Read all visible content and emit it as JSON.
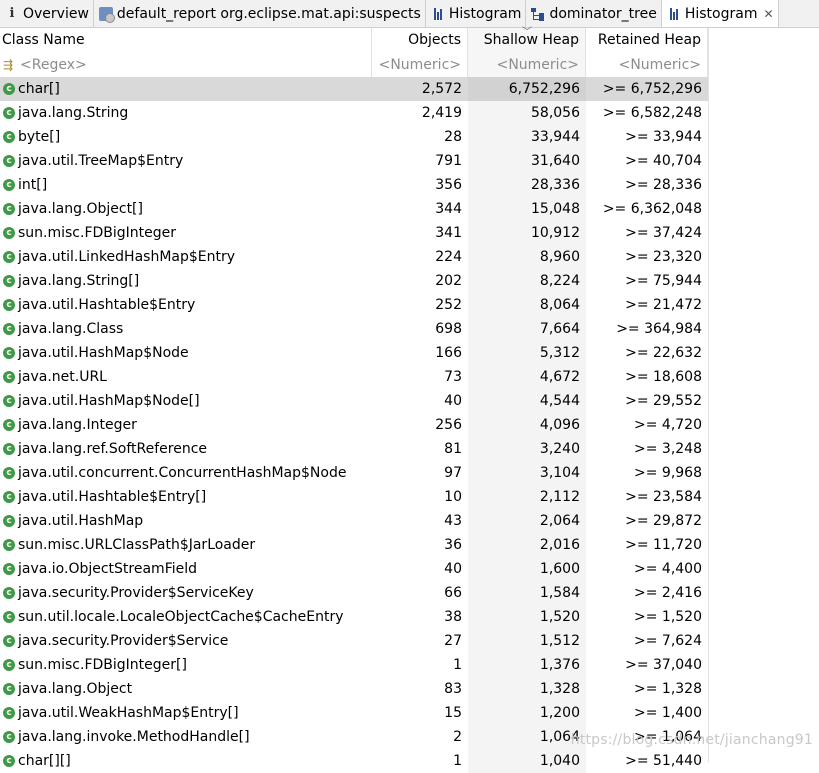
{
  "tabs": [
    {
      "label": "Overview",
      "icon": "info-icon",
      "active": false
    },
    {
      "label": "default_report  org.eclipse.mat.api:suspects",
      "icon": "report-icon",
      "active": false
    },
    {
      "label": "Histogram",
      "icon": "histogram-icon",
      "active": false
    },
    {
      "label": "dominator_tree",
      "icon": "dominator-tree-icon",
      "active": false
    },
    {
      "label": "Histogram",
      "icon": "histogram-icon",
      "active": true,
      "close": "✕"
    }
  ],
  "table": {
    "columns": [
      "Class Name",
      "Objects",
      "Shallow Heap",
      "Retained Heap"
    ],
    "filters": [
      "<Regex>",
      "<Numeric>",
      "<Numeric>",
      "<Numeric>"
    ],
    "sort_column": "Shallow Heap",
    "selected_row": 0,
    "rows": [
      {
        "name": "char[]",
        "objects": "2,572",
        "shallow": "6,752,296",
        "retained": ">= 6,752,296"
      },
      {
        "name": "java.lang.String",
        "objects": "2,419",
        "shallow": "58,056",
        "retained": ">= 6,582,248"
      },
      {
        "name": "byte[]",
        "objects": "28",
        "shallow": "33,944",
        "retained": ">= 33,944"
      },
      {
        "name": "java.util.TreeMap$Entry",
        "objects": "791",
        "shallow": "31,640",
        "retained": ">= 40,704"
      },
      {
        "name": "int[]",
        "objects": "356",
        "shallow": "28,336",
        "retained": ">= 28,336"
      },
      {
        "name": "java.lang.Object[]",
        "objects": "344",
        "shallow": "15,048",
        "retained": ">= 6,362,048"
      },
      {
        "name": "sun.misc.FDBigInteger",
        "objects": "341",
        "shallow": "10,912",
        "retained": ">= 37,424"
      },
      {
        "name": "java.util.LinkedHashMap$Entry",
        "objects": "224",
        "shallow": "8,960",
        "retained": ">= 23,320"
      },
      {
        "name": "java.lang.String[]",
        "objects": "202",
        "shallow": "8,224",
        "retained": ">= 75,944"
      },
      {
        "name": "java.util.Hashtable$Entry",
        "objects": "252",
        "shallow": "8,064",
        "retained": ">= 21,472"
      },
      {
        "name": "java.lang.Class",
        "objects": "698",
        "shallow": "7,664",
        "retained": ">= 364,984"
      },
      {
        "name": "java.util.HashMap$Node",
        "objects": "166",
        "shallow": "5,312",
        "retained": ">= 22,632"
      },
      {
        "name": "java.net.URL",
        "objects": "73",
        "shallow": "4,672",
        "retained": ">= 18,608"
      },
      {
        "name": "java.util.HashMap$Node[]",
        "objects": "40",
        "shallow": "4,544",
        "retained": ">= 29,552"
      },
      {
        "name": "java.lang.Integer",
        "objects": "256",
        "shallow": "4,096",
        "retained": ">= 4,720"
      },
      {
        "name": "java.lang.ref.SoftReference",
        "objects": "81",
        "shallow": "3,240",
        "retained": ">= 3,248"
      },
      {
        "name": "java.util.concurrent.ConcurrentHashMap$Node",
        "objects": "97",
        "shallow": "3,104",
        "retained": ">= 9,968"
      },
      {
        "name": "java.util.Hashtable$Entry[]",
        "objects": "10",
        "shallow": "2,112",
        "retained": ">= 23,584"
      },
      {
        "name": "java.util.HashMap",
        "objects": "43",
        "shallow": "2,064",
        "retained": ">= 29,872"
      },
      {
        "name": "sun.misc.URLClassPath$JarLoader",
        "objects": "36",
        "shallow": "2,016",
        "retained": ">= 11,720"
      },
      {
        "name": "java.io.ObjectStreamField",
        "objects": "40",
        "shallow": "1,600",
        "retained": ">= 4,400"
      },
      {
        "name": "java.security.Provider$ServiceKey",
        "objects": "66",
        "shallow": "1,584",
        "retained": ">= 2,416"
      },
      {
        "name": "sun.util.locale.LocaleObjectCache$CacheEntry",
        "objects": "38",
        "shallow": "1,520",
        "retained": ">= 1,520"
      },
      {
        "name": "java.security.Provider$Service",
        "objects": "27",
        "shallow": "1,512",
        "retained": ">= 7,624"
      },
      {
        "name": "sun.misc.FDBigInteger[]",
        "objects": "1",
        "shallow": "1,376",
        "retained": ">= 37,040"
      },
      {
        "name": "java.lang.Object",
        "objects": "83",
        "shallow": "1,328",
        "retained": ">= 1,328"
      },
      {
        "name": "java.util.WeakHashMap$Entry[]",
        "objects": "15",
        "shallow": "1,200",
        "retained": ">= 1,400"
      },
      {
        "name": "java.lang.invoke.MethodHandle[]",
        "objects": "2",
        "shallow": "1,064",
        "retained": ">= 1,064"
      },
      {
        "name": "char[][]",
        "objects": "1",
        "shallow": "1,040",
        "retained": ">= 51,440"
      }
    ]
  },
  "watermark": "https://blog.csdn.net/jianchang91",
  "colors": {
    "class_icon": "#3f9a47",
    "selection": "#d9d9d9",
    "sorted_column": "#f4f4f4"
  }
}
